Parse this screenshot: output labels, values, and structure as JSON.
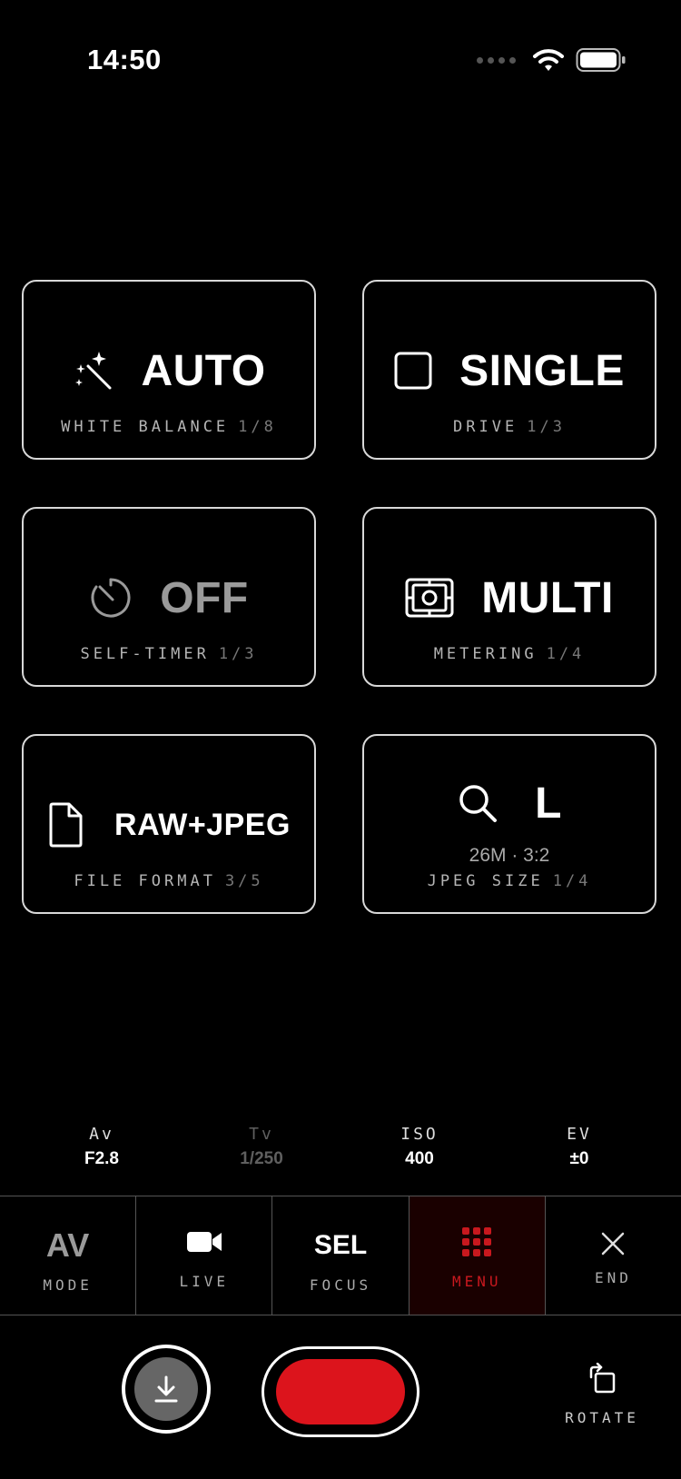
{
  "status_bar": {
    "time": "14:50"
  },
  "tiles": [
    {
      "id": "white-balance",
      "value": "AUTO",
      "label": "WHITE BALANCE",
      "count": "1/8",
      "icon": "magic-wand-icon"
    },
    {
      "id": "drive",
      "value": "SINGLE",
      "label": "DRIVE",
      "count": "1/3",
      "icon": "square-icon"
    },
    {
      "id": "self-timer",
      "value": "OFF",
      "label": "SELF-TIMER",
      "count": "1/3",
      "icon": "timer-icon"
    },
    {
      "id": "metering",
      "value": "MULTI",
      "label": "METERING",
      "count": "1/4",
      "icon": "metering-icon"
    },
    {
      "id": "file-format",
      "value": "RAW+JPEG",
      "label": "FILE FORMAT",
      "count": "3/5",
      "icon": "document-icon"
    },
    {
      "id": "jpeg-size",
      "value": "L",
      "sub": "26M · 3:2",
      "label": "JPEG SIZE",
      "count": "1/4",
      "icon": "magnifier-icon"
    }
  ],
  "exposure": [
    {
      "key": "Av",
      "value": "F2.8"
    },
    {
      "key": "Tv",
      "value": "1/250"
    },
    {
      "key": "ISO",
      "value": "400"
    },
    {
      "key": "EV",
      "value": "±0"
    }
  ],
  "toolbar": {
    "mode": {
      "value": "AV",
      "label": "MODE"
    },
    "live": {
      "label": "LIVE"
    },
    "focus": {
      "value": "SEL",
      "label": "FOCUS"
    },
    "menu": {
      "label": "MENU"
    },
    "end": {
      "label": "END"
    }
  },
  "rotate": {
    "label": "ROTATE"
  },
  "colors": {
    "accent_red": "#dc141c",
    "background": "#000000",
    "border": "#d8d8d8"
  }
}
